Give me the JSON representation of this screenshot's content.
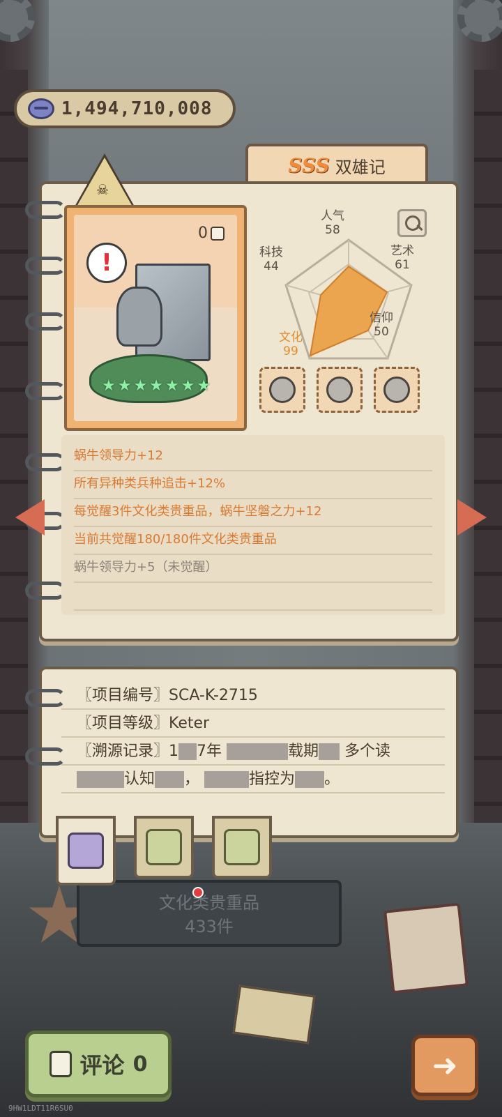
{
  "currency": {
    "amount": "1,494,710,008",
    "icon": "purple-gem-icon"
  },
  "item": {
    "rank": "SSS",
    "name": "双雄记",
    "piece_count": "0"
  },
  "stats": {
    "popularity": {
      "label": "人气",
      "value": "58"
    },
    "art": {
      "label": "艺术",
      "value": "61"
    },
    "faith": {
      "label": "信仰",
      "value": "50"
    },
    "culture": {
      "label": "文化",
      "value": "99"
    },
    "tech": {
      "label": "科技",
      "value": "44"
    }
  },
  "stars": 7,
  "effects": [
    "蜗牛领导力+12",
    "所有异种类兵种追击+12%",
    "每觉醒3件文化类贵重品，蜗牛坚磐之力+12",
    "当前共觉醒180/180件文化类贵重品",
    "蜗牛领导力+5（未觉醒）"
  ],
  "info": {
    "id_label": "〖项目编号〗",
    "id_value": "SCA-K-2715",
    "level_label": "〖项目等级〗",
    "level_value": "Keter",
    "origin_label": "〖溯源记录〗",
    "origin_part1": "1",
    "origin_part2": "7年",
    "origin_part3": "载期",
    "origin_part4": "多个读",
    "origin_part5": "认知",
    "origin_part6": "，",
    "origin_part7": "指控为",
    "origin_part8": "。"
  },
  "collection": {
    "category": "文化类贵重品",
    "count": "433件"
  },
  "comment": {
    "label": "评论",
    "count": "0"
  },
  "footer_code": "9HW1LDT11R6SU0",
  "colors": {
    "accent": "#e08c30",
    "effect_text": "#d87a34",
    "panel": "#efe6d2"
  }
}
